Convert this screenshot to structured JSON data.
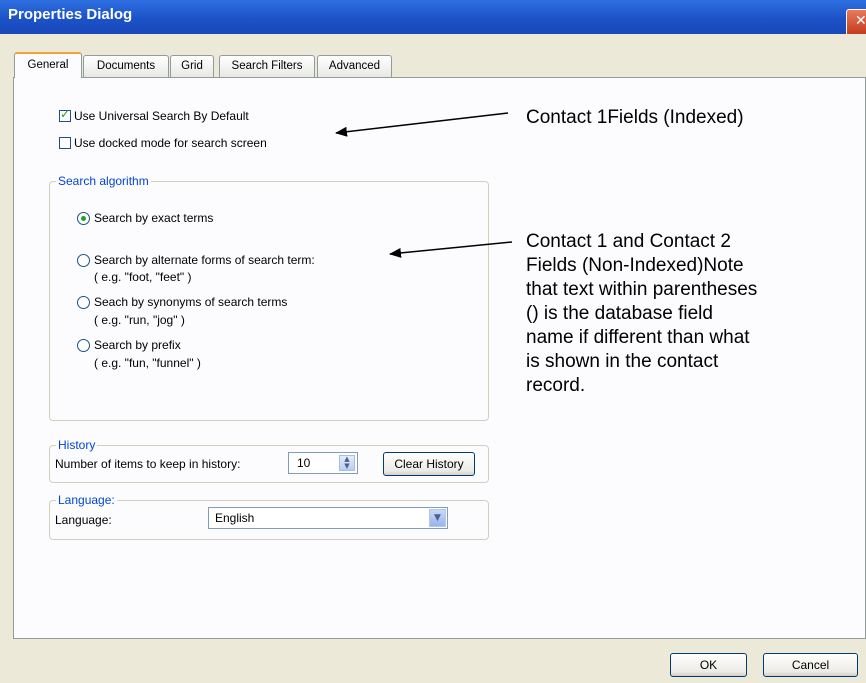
{
  "window": {
    "title": "Properties Dialog",
    "close_glyph": "✕"
  },
  "tabs": [
    {
      "label": "General",
      "active": true
    },
    {
      "label": "Documents"
    },
    {
      "label": "Grid"
    },
    {
      "label": "Search Filters"
    },
    {
      "label": "Advanced"
    }
  ],
  "general": {
    "universal_search": {
      "label": "Use Universal Search By Default",
      "checked": true
    },
    "docked_mode": {
      "label": "Use docked mode for search screen",
      "checked": false
    },
    "search_algorithm": {
      "legend": "Search algorithm",
      "options": [
        {
          "label": "Search by exact terms",
          "example": "",
          "selected": true
        },
        {
          "label": "Search by alternate forms of search term:",
          "example": "( e.g. \"foot, \"feet\" )",
          "selected": false
        },
        {
          "label": "Seach by synonyms of search terms",
          "example": "( e.g. \"run, \"jog\" )",
          "selected": false
        },
        {
          "label": "Search by prefix",
          "example": "( e.g. \"fun, \"funnel\" )",
          "selected": false
        }
      ]
    },
    "history": {
      "legend": "History",
      "label": "Number of items to keep in history:",
      "value": "10",
      "clear_button": "Clear History"
    },
    "language": {
      "legend": "Language:",
      "label": "Language:",
      "value": "English"
    }
  },
  "annotations": {
    "note1": "Contact 1Fields (Indexed)",
    "note2_lines": [
      "Contact 1 and Contact 2",
      "Fields (Non-Indexed)Note",
      "that text within parentheses",
      "() is the database field",
      "name if different than what",
      "is shown in the contact",
      "record."
    ]
  },
  "footer": {
    "ok": "OK",
    "cancel": "Cancel"
  },
  "colors": {
    "titlebar": "#1c52c8",
    "dialog_bg": "#ece9d8",
    "panel_bg": "#fcfcfe",
    "group_legend": "#0046d5",
    "check_green": "#21a121"
  },
  "icons": {
    "close": "close-icon",
    "check": "checkmark-icon",
    "spin": "spinner-arrows-icon",
    "dropdown": "chevron-down-icon"
  }
}
